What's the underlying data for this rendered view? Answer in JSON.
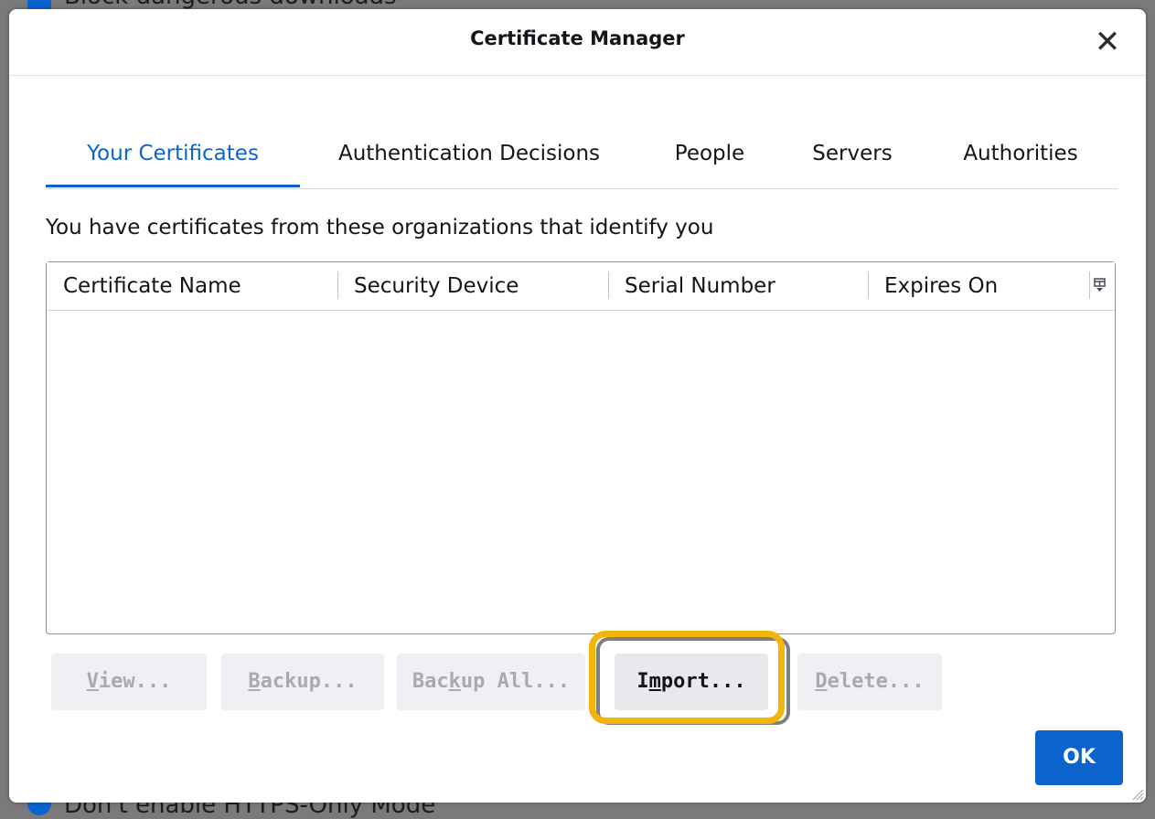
{
  "background": {
    "top_option": "Block dangerous downloads",
    "bottom_option": "Don't enable HTTPS-Only Mode"
  },
  "dialog": {
    "title": "Certificate Manager",
    "close_glyph": "✕"
  },
  "tabs": [
    {
      "label": "Your Certificates",
      "selected": true
    },
    {
      "label": "Authentication Decisions",
      "selected": false
    },
    {
      "label": "People",
      "selected": false
    },
    {
      "label": "Servers",
      "selected": false
    },
    {
      "label": "Authorities",
      "selected": false
    }
  ],
  "intro_text": "You have certificates from these organizations that identify you",
  "table": {
    "columns": [
      "Certificate Name",
      "Security Device",
      "Serial Number",
      "Expires On"
    ],
    "rows": []
  },
  "buttons": {
    "view": {
      "pre": "",
      "key": "V",
      "post": "iew..."
    },
    "backup": {
      "pre": "",
      "key": "B",
      "post": "ackup..."
    },
    "backup_all": {
      "pre": "Bac",
      "key": "k",
      "post": "up All..."
    },
    "import": {
      "pre": "I",
      "key": "m",
      "post": "port..."
    },
    "delete": {
      "pre": "",
      "key": "D",
      "post": "elete..."
    },
    "ok": "OK"
  },
  "colors": {
    "accent": "#0b63ce",
    "highlight": "#f3b50c"
  }
}
